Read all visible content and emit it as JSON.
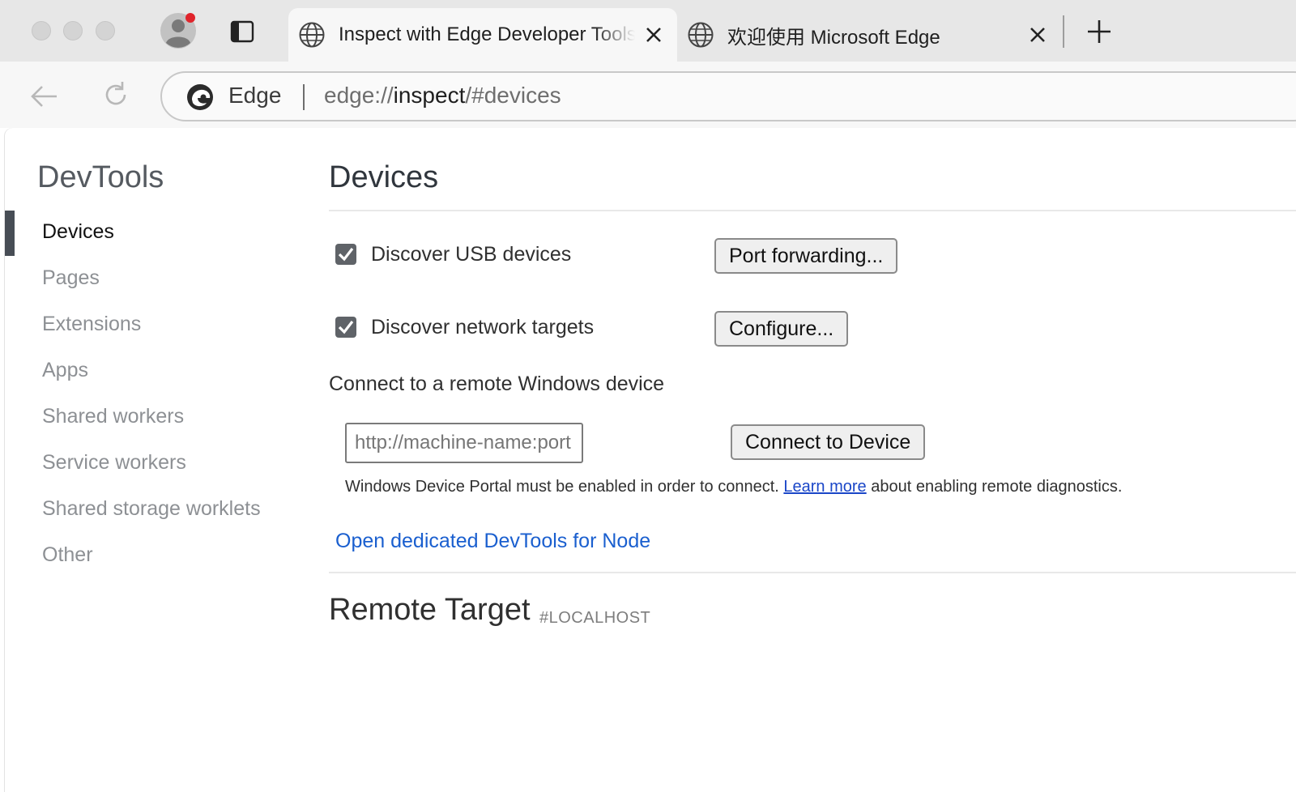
{
  "browser": {
    "tabs": [
      {
        "title": "Inspect with Edge Developer Tools",
        "active": true
      },
      {
        "title": "欢迎使用 Microsoft Edge",
        "active": false
      }
    ],
    "omnibox": {
      "chip": "Edge",
      "url_scheme": "edge://",
      "url_host": "inspect",
      "url_rest": "/#devices"
    }
  },
  "sidebar": {
    "title": "DevTools",
    "items": [
      {
        "label": "Devices",
        "selected": true
      },
      {
        "label": "Pages"
      },
      {
        "label": "Extensions"
      },
      {
        "label": "Apps"
      },
      {
        "label": "Shared workers"
      },
      {
        "label": "Service workers"
      },
      {
        "label": "Shared storage worklets"
      },
      {
        "label": "Other"
      }
    ]
  },
  "main": {
    "title": "Devices",
    "usb": {
      "label": "Discover USB devices",
      "checked": true,
      "button": "Port forwarding..."
    },
    "network": {
      "label": "Discover network targets",
      "checked": true,
      "button": "Configure..."
    },
    "remote_windows": {
      "label": "Connect to a remote Windows device",
      "placeholder": "http://machine-name:port",
      "button": "Connect to Device",
      "note_before": "Windows Device Portal must be enabled in order to connect. ",
      "note_link": "Learn more",
      "note_after": " about enabling remote diagnostics."
    },
    "node_link": "Open dedicated DevTools for Node",
    "remote_target": {
      "title": "Remote Target",
      "tag": "#LOCALHOST"
    }
  },
  "colors": {
    "tabstrip_bg": "#e7e7e7",
    "link_blue": "#1a5fcf",
    "selected_indicator": "#474d55",
    "checkbox": "#5f6368"
  }
}
